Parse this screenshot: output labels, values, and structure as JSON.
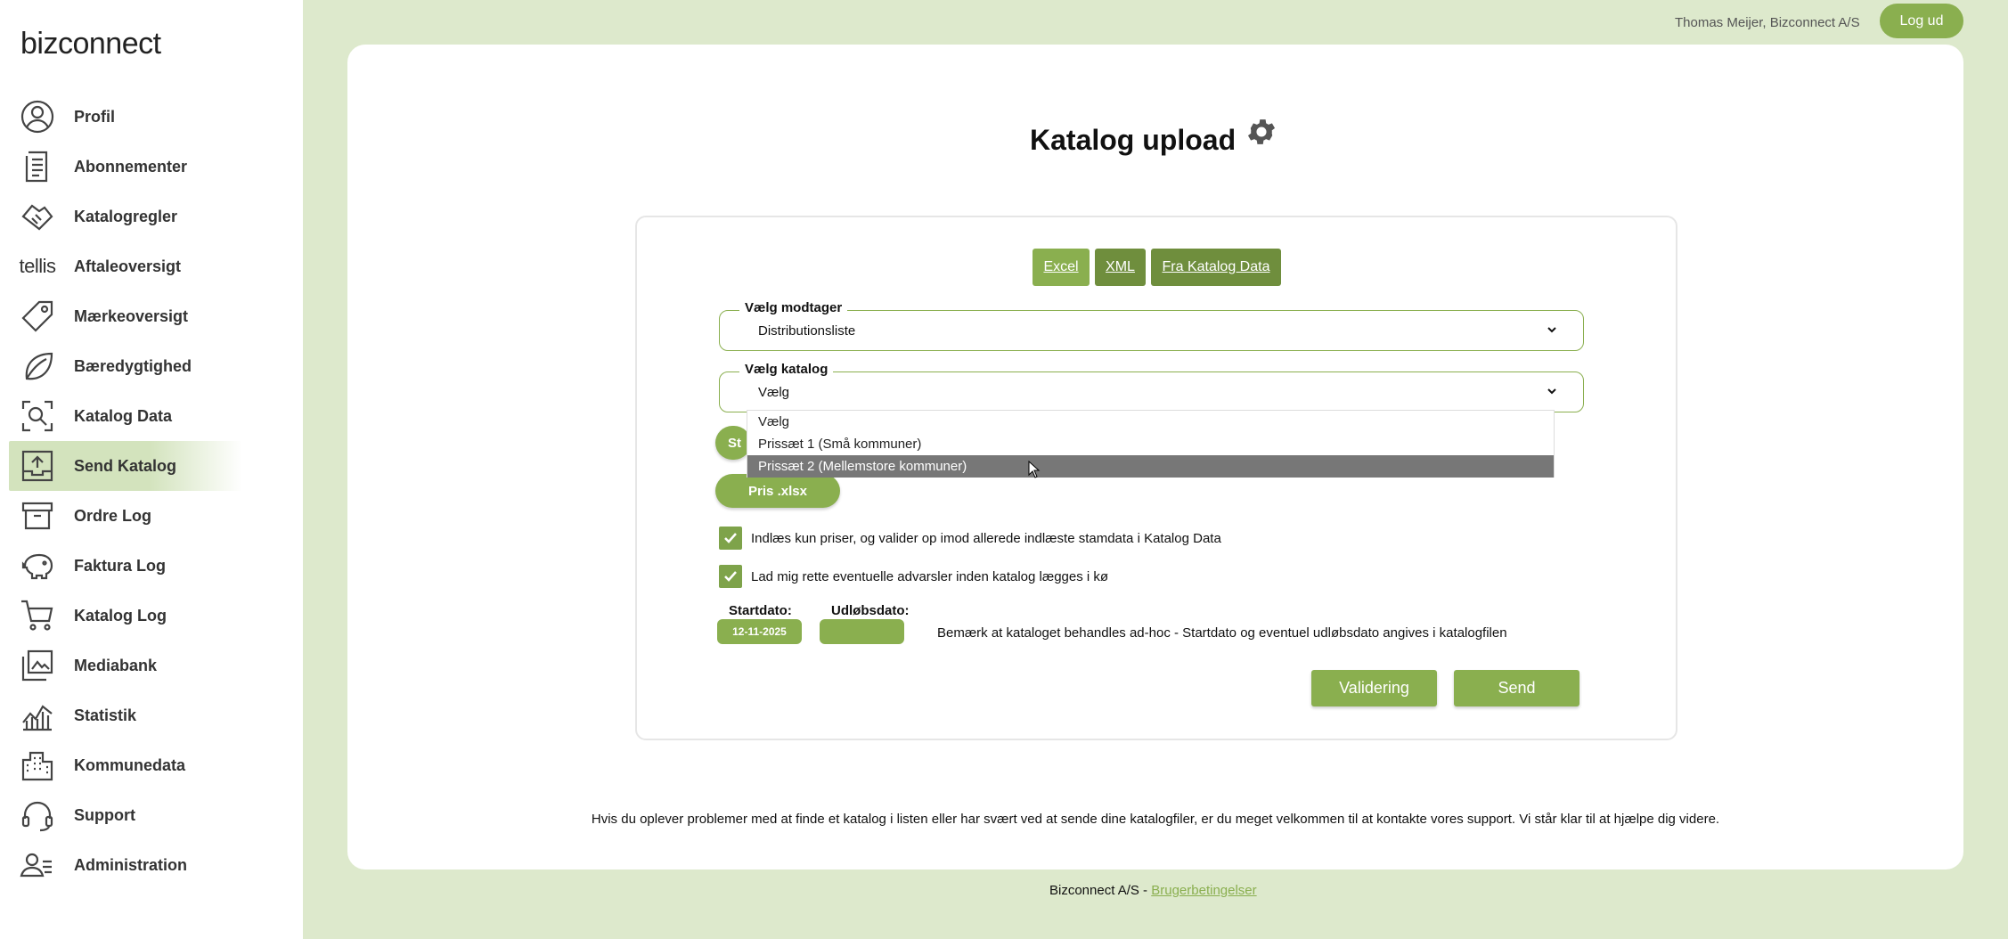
{
  "brand": {
    "logo_text": "bizconnect"
  },
  "sidebar": {
    "items": [
      {
        "label": "Profil",
        "icon": "profile-icon"
      },
      {
        "label": "Abonnementer",
        "icon": "document-icon"
      },
      {
        "label": "Katalogregler",
        "icon": "handshake-icon"
      },
      {
        "label": "Aftaleoversigt",
        "icon": "tellis-logo",
        "icon_text": "tellis"
      },
      {
        "label": "Mærkeoversigt",
        "icon": "tag-icon"
      },
      {
        "label": "Bæredygtighed",
        "icon": "leaf-icon"
      },
      {
        "label": "Katalog Data",
        "icon": "search-doc-icon"
      },
      {
        "label": "Send Katalog",
        "icon": "upload-icon",
        "active": true
      },
      {
        "label": "Ordre Log",
        "icon": "box-icon"
      },
      {
        "label": "Faktura Log",
        "icon": "piggy-bank-icon"
      },
      {
        "label": "Katalog Log",
        "icon": "cart-icon"
      },
      {
        "label": "Mediabank",
        "icon": "media-icon"
      },
      {
        "label": "Statistik",
        "icon": "chart-icon"
      },
      {
        "label": "Kommunedata",
        "icon": "building-icon"
      },
      {
        "label": "Support",
        "icon": "headset-icon"
      },
      {
        "label": "Administration",
        "icon": "users-icon"
      }
    ]
  },
  "header": {
    "user": "Thomas Meijer, Bizconnect A/S",
    "logout_label": "Log ud"
  },
  "main": {
    "title": "Katalog upload",
    "tabs": [
      {
        "label": "Excel"
      },
      {
        "label": "XML"
      },
      {
        "label": "Fra Katalog Data"
      }
    ],
    "recipient": {
      "legend": "Vælg modtager",
      "value": "Distributionsliste"
    },
    "catalog": {
      "legend": "Vælg katalog",
      "value": "Vælg",
      "options": [
        "Vælg",
        "Prissæt 1 (Små kommuner)",
        "Prissæt 2 (Mellemstore kommuner)"
      ],
      "highlighted": "Prissæt 2 (Mellemstore kommuner)"
    },
    "hidden_button_label": "St",
    "price_button_label": "Pris .xlsx",
    "checkboxes": [
      {
        "label": "Indlæs kun priser, og valider op imod allerede indlæste stamdata i Katalog Data",
        "checked": true
      },
      {
        "label": "Lad mig rette eventuelle advarsler inden katalog lægges i kø",
        "checked": true
      }
    ],
    "start_date": {
      "label": "Startdato:",
      "value": "12-11-2025"
    },
    "end_date": {
      "label": "Udløbsdato:",
      "value": ""
    },
    "note": "Bemærk at kataloget behandles ad-hoc - Startdato og eventuel udløbsdato angives i katalogfilen",
    "validate_label": "Validering",
    "send_label": "Send",
    "support_text": "Hvis du oplever problemer med at finde et katalog i listen eller har svært ved at sende dine katalogfiler, er du meget velkommen til at kontakte vores support. Vi står klar til at hjælpe dig videre."
  },
  "footer": {
    "company": "Bizconnect A/S - ",
    "link": "Brugerbetingelser"
  },
  "colors": {
    "accent": "#8aaf4f",
    "accent_dark": "#6f8e3d",
    "background": "#dde9cc"
  }
}
